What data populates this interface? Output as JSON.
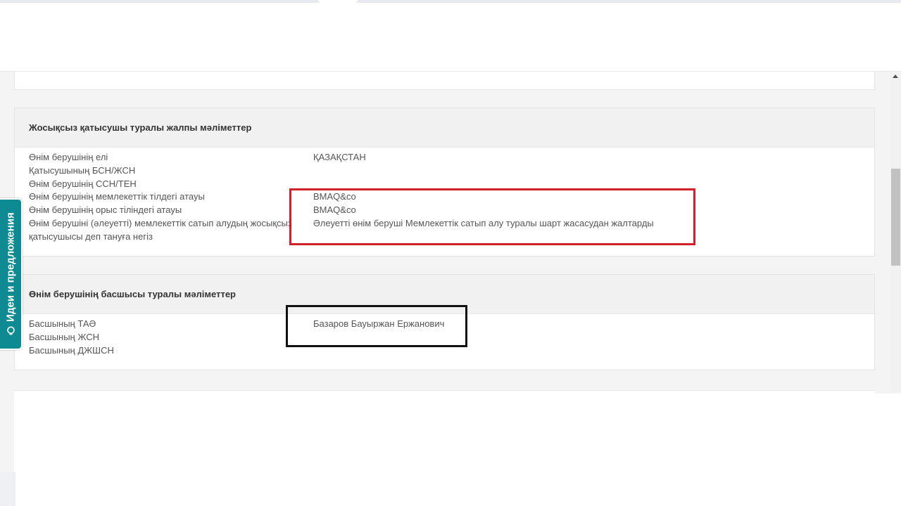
{
  "previous_section": {
    "cut_text": "…"
  },
  "participant_section": {
    "title": "Жосықсыз қатысушы туралы жалпы мәліметтер",
    "rows": [
      {
        "label": "Өнім берушінің елі",
        "value": "ҚАЗАҚСТАН"
      },
      {
        "label": "Қатысушының БСН/ЖСН",
        "value": ""
      },
      {
        "label": "Өнім берушінің ССН/ТЕН",
        "value": ""
      },
      {
        "label": "Өнім берушінің мемлекеттік тілдегі атауы",
        "value": "BMAQ&co"
      },
      {
        "label": "Өнім берушінің орыс тіліндегі атауы",
        "value": "BMAQ&co"
      },
      {
        "label": "Өнім берушіні (әлеуетті) мемлекеттік сатып алудың жосықсыз қатысушысы деп тануға негіз",
        "value": "Әлеуетті өнім беруші Мемлекеттік сатып алу туралы шарт жасасудан жалтарды"
      }
    ]
  },
  "head_section": {
    "title": "Өнім берушінің басшысы туралы мәліметтер",
    "rows": [
      {
        "label": "Басшының ТАӘ",
        "value": "Базаров Бауыржан Ержанович"
      },
      {
        "label": "Басшының ЖСН",
        "value": ""
      },
      {
        "label": "Басшының ДЖШСН",
        "value": ""
      }
    ]
  },
  "feedback_tab": {
    "label": "Идеи и предложения",
    "icon": "lightbulb-icon",
    "color": "#0e8a93"
  },
  "annotations": {
    "red_box_color": "#d1202a",
    "black_box_color": "#111111"
  }
}
